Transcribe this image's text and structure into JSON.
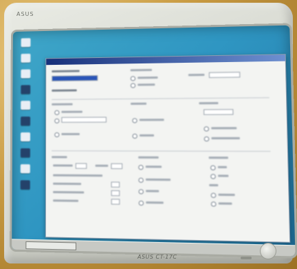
{
  "photo": {
    "top_bezel_logo": "ASUS",
    "bottom_bezel_logo": "ASUS CT-17C"
  },
  "screen": {
    "desktop_color": "#2f96c2",
    "window_titlebar_color": "#17307a"
  }
}
